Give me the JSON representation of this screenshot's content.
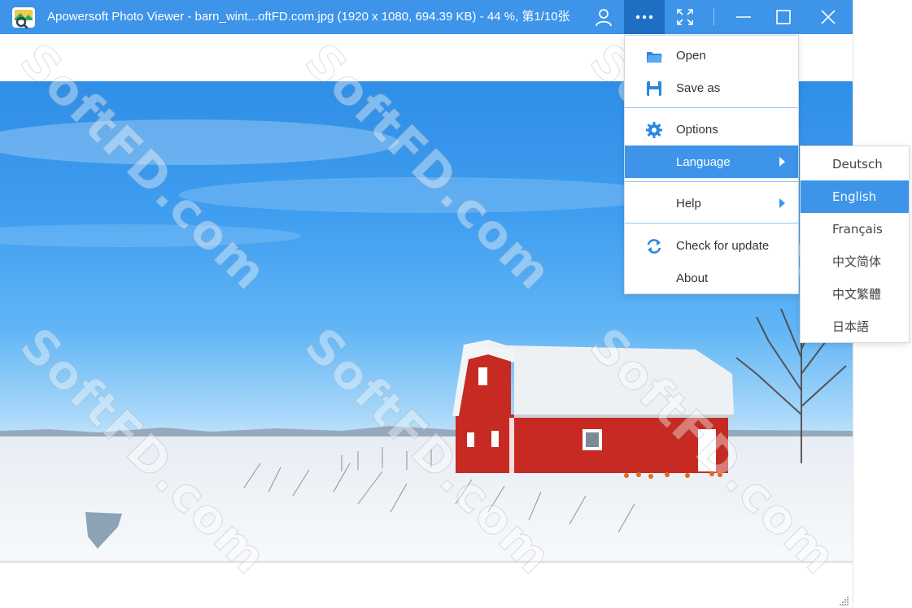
{
  "window": {
    "title": "Apowersoft Photo Viewer - barn_wint...oftFD.com.jpg (1920 x 1080, 694.39 KB) - 44 %, 第1/10张"
  },
  "titlebar": {
    "icons": [
      "app-logo-icon",
      "user-icon",
      "more-icon",
      "fullscreen-icon",
      "minimize-icon",
      "maximize-icon",
      "close-icon"
    ],
    "accent_color": "#3d94e9",
    "active_color": "#1e6fc4"
  },
  "menu": {
    "items": [
      {
        "label": "Open",
        "icon": "folder-icon"
      },
      {
        "label": "Save as",
        "icon": "save-icon"
      },
      {
        "label": "Options",
        "icon": "gear-icon"
      },
      {
        "label": "Language",
        "icon": "",
        "highlighted": true,
        "submenu": true
      },
      {
        "label": "Help",
        "icon": "",
        "submenu": true
      },
      {
        "label": "Check for update",
        "icon": "refresh-icon"
      },
      {
        "label": "About",
        "icon": ""
      }
    ]
  },
  "language_submenu": {
    "items": [
      "Deutsch",
      "English",
      "Français",
      "中文简体",
      "中文繁體",
      "日本語"
    ],
    "selected": "English"
  },
  "watermark": {
    "text": "SoftFD.com"
  }
}
